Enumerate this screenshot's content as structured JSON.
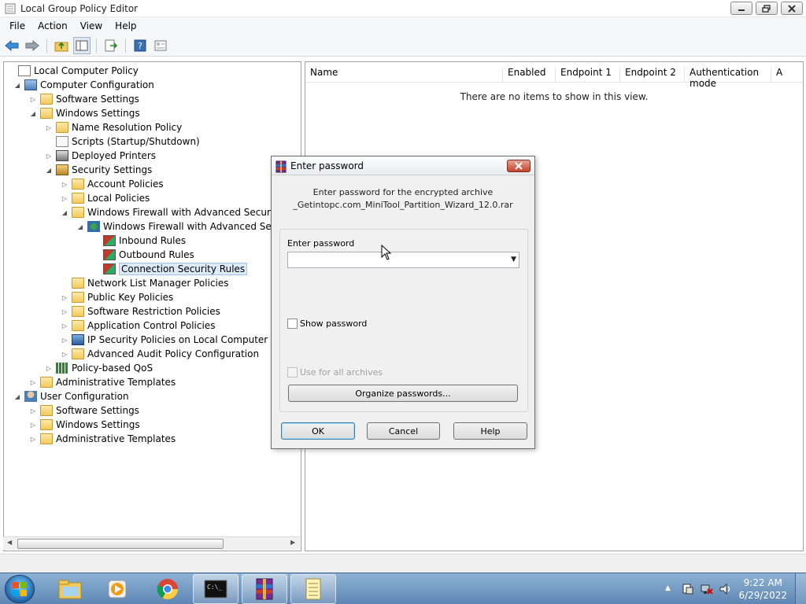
{
  "window": {
    "title": "Local Group Policy Editor",
    "minimize": "0",
    "maximize": "1",
    "close": "r"
  },
  "menu": [
    "File",
    "Action",
    "View",
    "Help"
  ],
  "toolbar": {
    "icons": [
      "back-arrow-icon",
      "forward-arrow-icon",
      "up-folder-icon",
      "show-hide-tree-icon",
      "export-list-icon",
      "help-icon",
      "properties-icon"
    ]
  },
  "tree": [
    {
      "label": "Local Computer Policy",
      "expander": ""
    },
    {
      "label": "Computer Configuration",
      "expander": "◢"
    },
    {
      "label": "Software Settings",
      "expander": "▷"
    },
    {
      "label": "Windows Settings",
      "expander": "◢"
    },
    {
      "label": "Name Resolution Policy",
      "expander": "▷"
    },
    {
      "label": "Scripts (Startup/Shutdown)",
      "expander": ""
    },
    {
      "label": "Deployed Printers",
      "expander": "▷"
    },
    {
      "label": "Security Settings",
      "expander": "◢"
    },
    {
      "label": "Account Policies",
      "expander": "▷"
    },
    {
      "label": "Local Policies",
      "expander": "▷"
    },
    {
      "label": "Windows Firewall with Advanced Security",
      "expander": "◢"
    },
    {
      "label": "Windows Firewall with Advanced Security",
      "expander": "◢"
    },
    {
      "label": "Inbound Rules",
      "expander": ""
    },
    {
      "label": "Outbound Rules",
      "expander": ""
    },
    {
      "label": "Connection Security Rules",
      "expander": "",
      "selected": true
    },
    {
      "label": "Network List Manager Policies",
      "expander": ""
    },
    {
      "label": "Public Key Policies",
      "expander": "▷"
    },
    {
      "label": "Software Restriction Policies",
      "expander": "▷"
    },
    {
      "label": "Application Control Policies",
      "expander": "▷"
    },
    {
      "label": "IP Security Policies on Local Computer",
      "expander": "▷"
    },
    {
      "label": "Advanced Audit Policy Configuration",
      "expander": "▷"
    },
    {
      "label": "Policy-based QoS",
      "expander": "▷"
    },
    {
      "label": "Administrative Templates",
      "expander": "▷"
    },
    {
      "label": "User Configuration",
      "expander": "◢"
    },
    {
      "label": "Software Settings",
      "expander": "▷"
    },
    {
      "label": "Windows Settings",
      "expander": "▷"
    },
    {
      "label": "Administrative Templates",
      "expander": "▷"
    }
  ],
  "list": {
    "columns": [
      "Name",
      "Enabled",
      "Endpoint 1",
      "Endpoint 2",
      "Authentication mode",
      "A"
    ],
    "empty_message": "There are no items to show in this view."
  },
  "dialog": {
    "title": "Enter password",
    "close": "X",
    "message_line1": "Enter password for the encrypted archive",
    "message_line2": "_Getintopc.com_MiniTool_Partition_Wizard_12.0.rar",
    "password_label": "Enter password",
    "password_value": "",
    "dropdown_arrow": "▼",
    "show_password": "Show password",
    "use_for_all": "Use for all archives",
    "organize": "Organize passwords...",
    "ok": "OK",
    "cancel": "Cancel",
    "help": "Help"
  },
  "taskbar": {
    "items": [
      "explorer-icon",
      "media-player-icon",
      "chrome-icon",
      "command-prompt-icon",
      "winrar-icon",
      "notepad-icon"
    ],
    "tray_arrow": "▲",
    "time": "9:22 AM",
    "date": "6/29/2022"
  },
  "colors": {
    "selection": "#dceaf8",
    "dialog_close": "#c5452f",
    "taskbar": "#6f95bf"
  }
}
